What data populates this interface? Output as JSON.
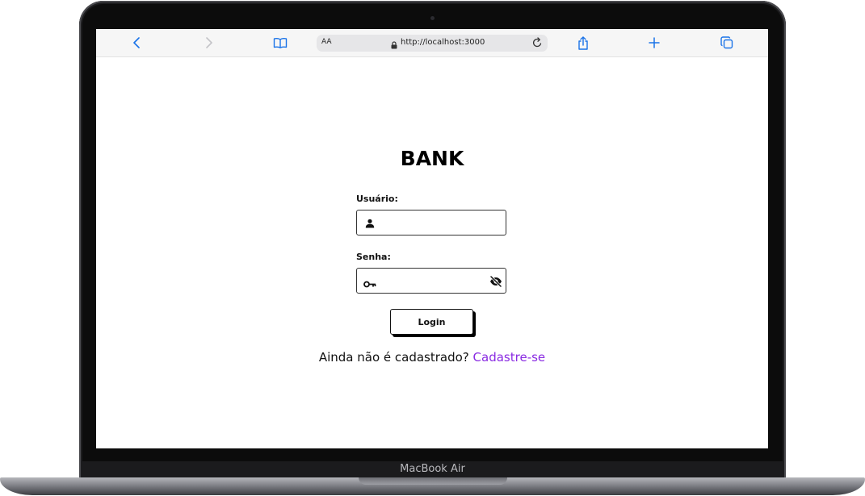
{
  "device": {
    "label": "MacBook Air"
  },
  "browser": {
    "aa_label": "AA",
    "url": "http://localhost:3000",
    "icons": {
      "back": "chevron-left-icon",
      "forward": "chevron-right-icon",
      "bookmarks": "book-icon",
      "lock": "lock-icon",
      "reload": "reload-icon",
      "share": "share-icon",
      "new_tab": "plus-icon",
      "tabs": "tabs-icon"
    },
    "accent_color": "#1a73e8"
  },
  "login": {
    "title": "BANK",
    "username_label": "Usuário:",
    "username_value": "",
    "password_label": "Senha:",
    "password_value": "",
    "username_icon": "user-icon",
    "password_icon": "key-icon",
    "visibility_icon": "eye-off-icon",
    "button_label": "Login",
    "signup_prompt": "Ainda não é cadastrado?",
    "signup_link": "Cadastre-se",
    "link_color": "#8a2be2"
  }
}
